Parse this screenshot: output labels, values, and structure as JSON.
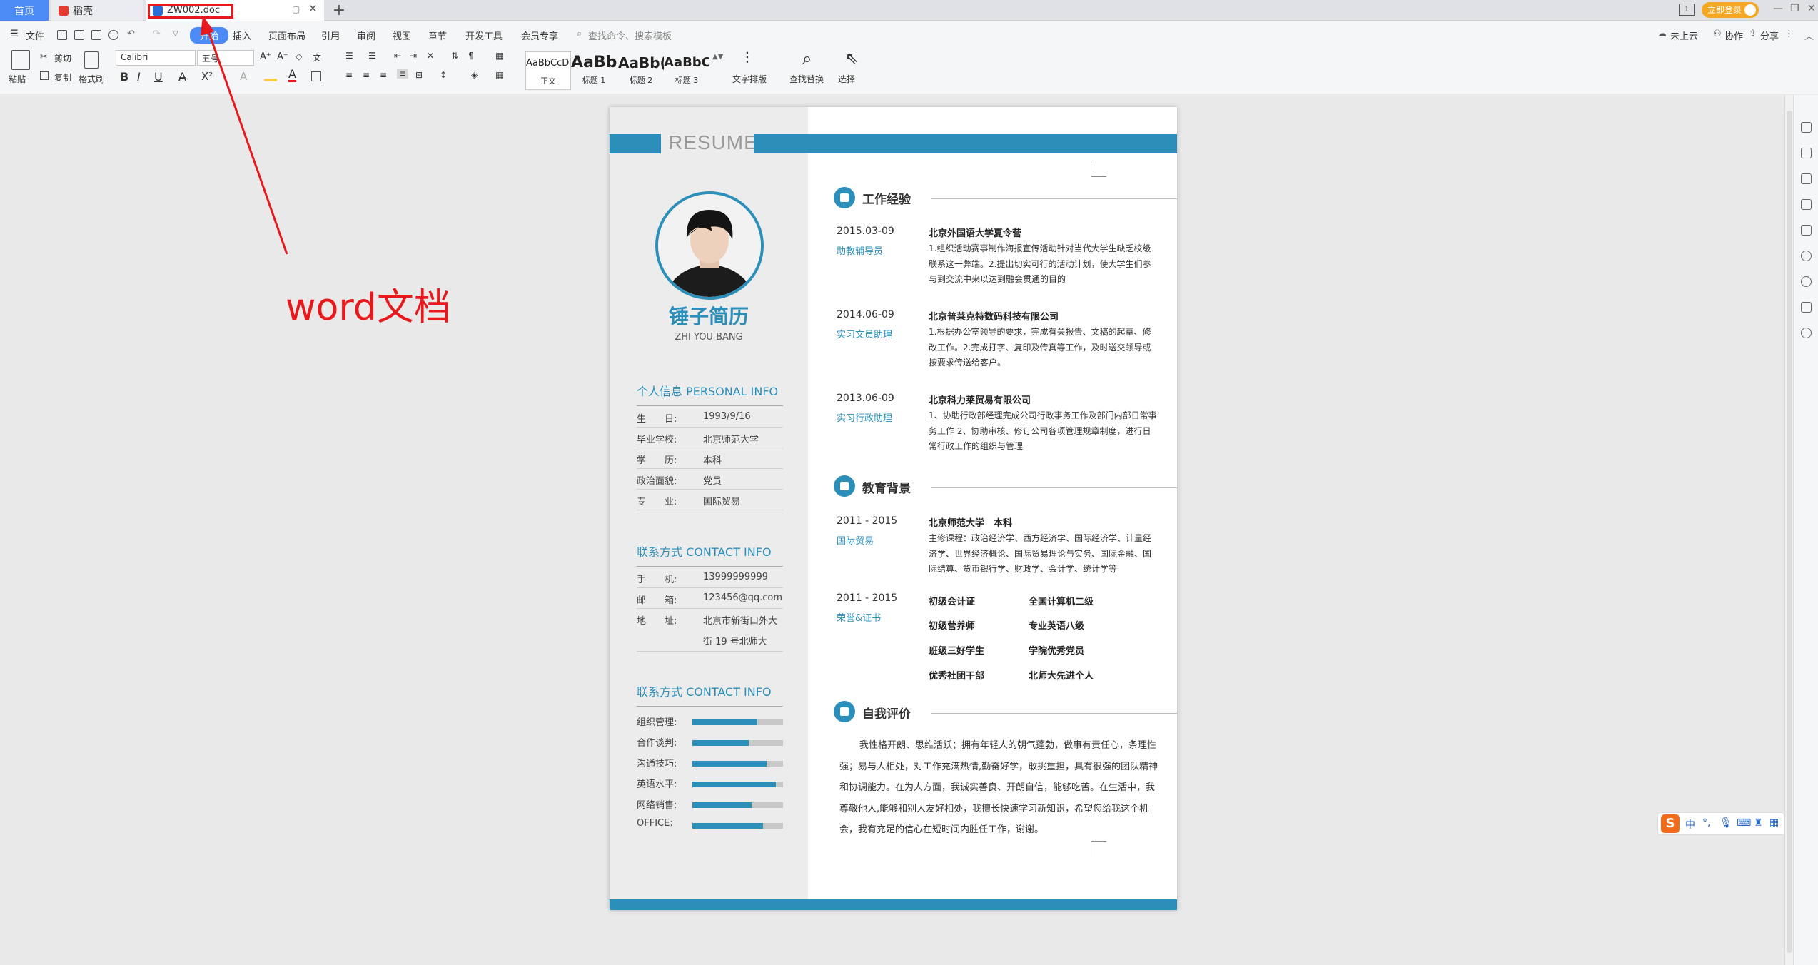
{
  "tabs": {
    "home": "首页",
    "docer": "稻壳",
    "doc": "ZW002.doc",
    "add": "+"
  },
  "titlebar_right": {
    "window_badge": "1",
    "login": "立即登录"
  },
  "menu": {
    "file": "文件",
    "start": "开始",
    "insert": "插入",
    "layout": "页面布局",
    "reference": "引用",
    "review": "审阅",
    "view": "视图",
    "chapter": "章节",
    "devtools": "开发工具",
    "member": "会员专享",
    "search": "查找命令、搜索模板",
    "cloud": "未上云",
    "collab": "协作",
    "share": "分享"
  },
  "ribbon": {
    "paste": "粘贴",
    "cut": "剪切",
    "copy": "复制",
    "format_painter": "格式刷",
    "font_name": "Calibri",
    "font_size": "五号",
    "styles": [
      {
        "preview": "AaBbCcDd",
        "label": "正文"
      },
      {
        "preview": "AaBb",
        "label": "标题 1"
      },
      {
        "preview": "AaBb(",
        "label": "标题 2"
      },
      {
        "preview": "AaBbC",
        "label": "标题 3"
      }
    ],
    "text_layout": "文字排版",
    "find_replace": "查找替换",
    "select": "选择"
  },
  "annotation": {
    "label": "word文档"
  },
  "resume": {
    "header_word": "RESUME",
    "name": "锤子简历",
    "pinyin": "ZHI YOU BANG",
    "personal_title": "个人信息  PERSONAL INFO",
    "personal": [
      {
        "k": "生　　日:",
        "v": "1993/9/16"
      },
      {
        "k": "毕业学校:",
        "v": "北京师范大学"
      },
      {
        "k": "学　　历:",
        "v": "本科"
      },
      {
        "k": "政治面貌:",
        "v": "党员"
      },
      {
        "k": "专　　业:",
        "v": "国际贸易"
      }
    ],
    "contact_title": "联系方式  CONTACT INFO",
    "contact": [
      {
        "k": "手　　机:",
        "v": "13999999999"
      },
      {
        "k": "邮　　箱:",
        "v": "123456@qq.com"
      },
      {
        "k": "地　　址:",
        "v": "北京市新街口外大"
      }
    ],
    "address_line2": "街 19 号北师大",
    "skills_title": "联系方式  CONTACT INFO",
    "skills": [
      {
        "k": "组织管理:",
        "level": 0.72
      },
      {
        "k": "合作谈判:",
        "level": 0.62
      },
      {
        "k": "沟通技巧:",
        "level": 0.82
      },
      {
        "k": "英语水平:",
        "level": 0.92
      },
      {
        "k": "网络销售:",
        "level": 0.65
      },
      {
        "k": "OFFICE:",
        "level": 0.78
      }
    ],
    "work_title": "工作经验",
    "work": [
      {
        "date": "2015.03-09",
        "role": "助教辅导员",
        "org": "北京外国语大学夏令营",
        "desc": "1.组织活动赛事制作海报宣传活动针对当代大学生缺乏校级联系这一弊端。2.提出切实可行的活动计划，使大学生们参与到交流中来以达到融会贯通的目的"
      },
      {
        "date": "2014.06-09",
        "role": "实习文员助理",
        "org": "北京普莱克特数码科技有限公司",
        "desc": "1.根据办公室领导的要求，完成有关报告、文稿的起草、修改工作。2.完成打字、复印及传真等工作，及时送交领导或按要求传送给客户。"
      },
      {
        "date": "2013.06-09",
        "role": "实习行政助理",
        "org": "北京科力莱贸易有限公司",
        "desc": "1、协助行政部经理完成公司行政事务工作及部门内部日常事务工作 2、协助审核、修订公司各项管理规章制度，进行日常行政工作的组织与管理"
      }
    ],
    "edu_title": "教育背景",
    "edu": {
      "date": "2011 - 2015",
      "major": "国际贸易",
      "school": "北京师范大学　本科",
      "courses": "主修课程：政治经济学、西方经济学、国际经济学、计量经济学、世界经济概论、国际贸易理论与实务、国际金融、国际结算、货币银行学、财政学、会计学、统计学等"
    },
    "honor": {
      "date": "2011 - 2015",
      "label": "荣誉&证书",
      "certs": [
        "初级会计证",
        "全国计算机二级",
        "初级营养师",
        "专业英语八级",
        "班级三好学生",
        "学院优秀党员",
        "优秀社团干部",
        "北师大先进个人"
      ]
    },
    "self_title": "自我评价",
    "self_text": "我性格开朗、思维活跃；拥有年轻人的朝气蓬勃，做事有责任心，条理性强；易与人相处，对工作充满热情,勤奋好学，敢挑重担，具有很强的团队精神和协调能力。在为人方面，我诚实善良、开朗自信，能够吃苦。在生活中，我尊敬他人,能够和别人友好相处，我擅长快速学习新知识，希望您给我这个机会，我有充足的信心在短时间内胜任工作，谢谢。"
  },
  "ime": {
    "mode": "中"
  },
  "colors": {
    "accent": "#2b8fba",
    "annotation": "#e8191c",
    "tab_active": "#4c8bf5"
  }
}
